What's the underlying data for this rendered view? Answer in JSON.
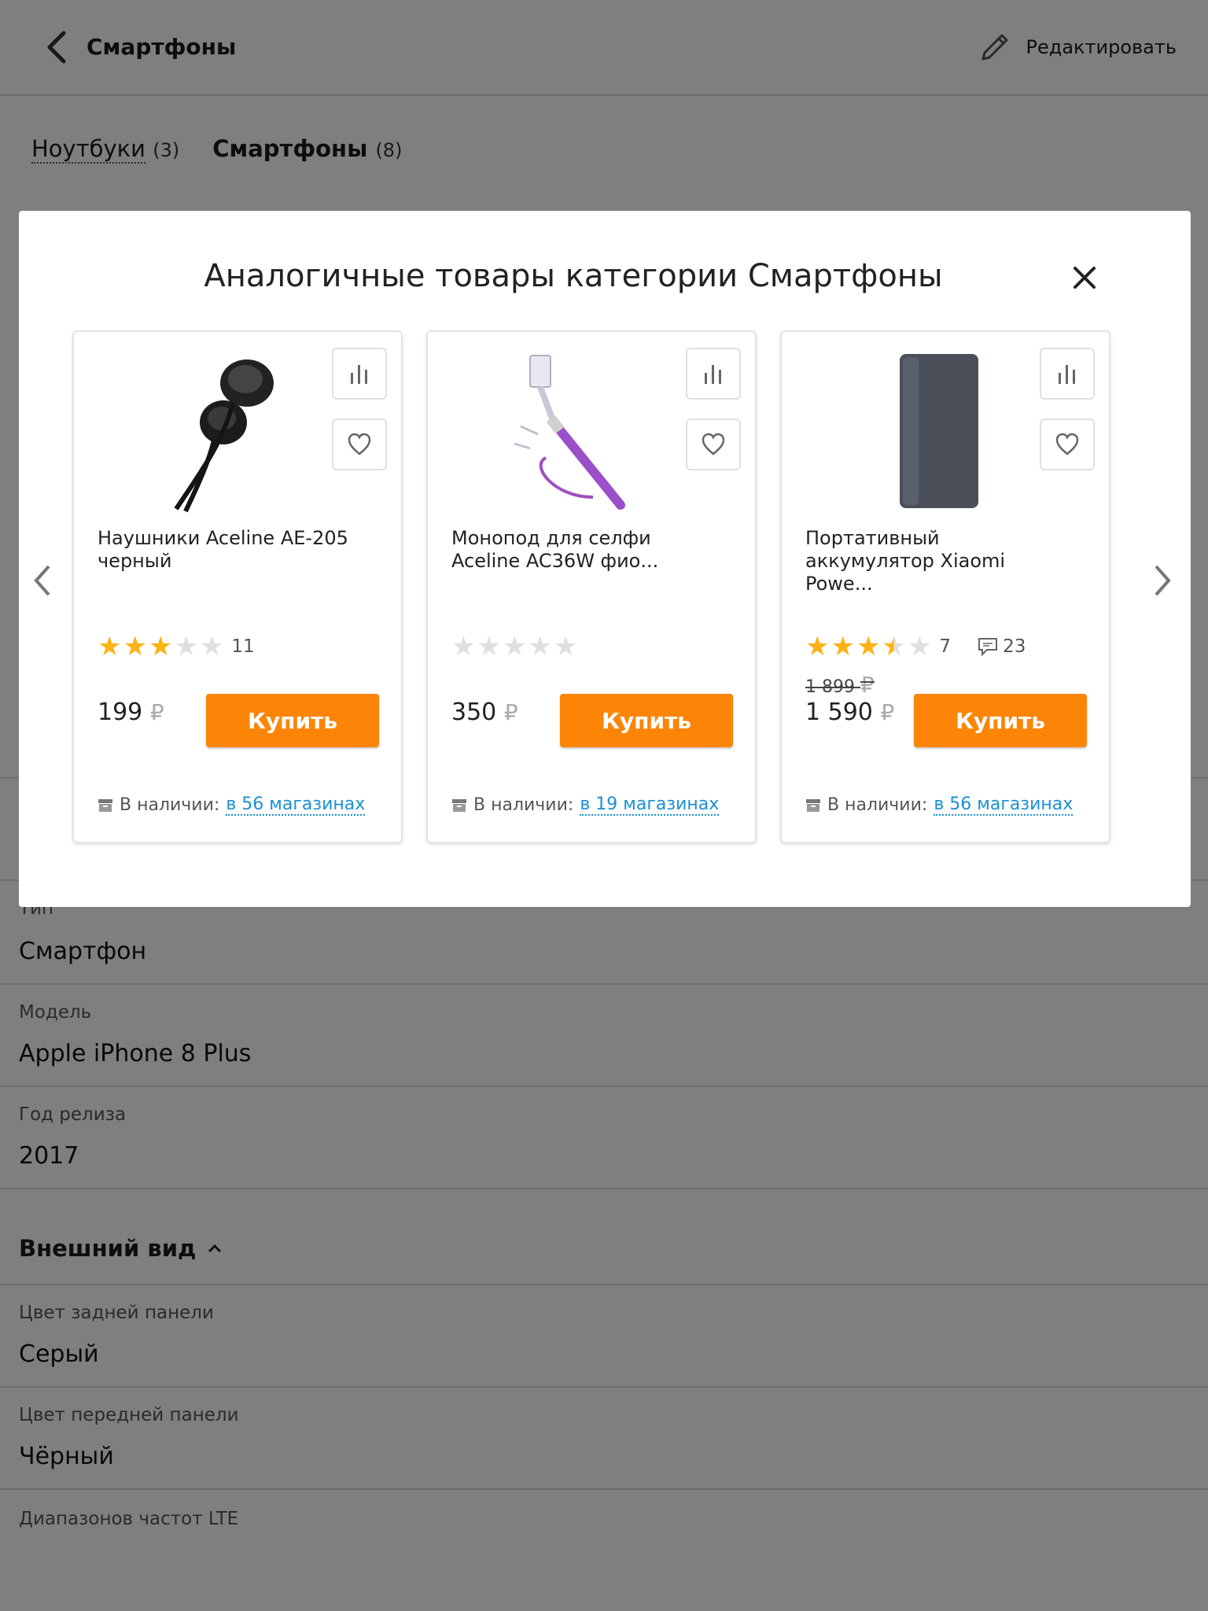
{
  "header": {
    "title": "Смартфоны",
    "edit_label": "Редактировать"
  },
  "tabs": [
    {
      "label": "Ноутбуки",
      "count": "(3)"
    },
    {
      "label": "Смартфоны",
      "count": "(8)"
    }
  ],
  "specs": {
    "type": {
      "label": "Тип",
      "value": "Смартфон"
    },
    "model": {
      "label": "Модель",
      "value": "Apple iPhone 8 Plus"
    },
    "year": {
      "label": "Год релиза",
      "value": "2017"
    },
    "section_title": "Внешний вид",
    "back_color": {
      "label": "Цвет задней панели",
      "value": "Серый"
    },
    "front_color": {
      "label": "Цвет передней панели",
      "value": "Чёрный"
    },
    "lte": {
      "label": "Диапазонов частот LTE"
    }
  },
  "modal": {
    "title": "Аналогичные товары категории Смартфоны",
    "currency": "₽",
    "buy_label": "Купить",
    "avail_prefix": "В наличии:",
    "cards": [
      {
        "name": "Наушники Aceline AE-205 черный",
        "rating": 3,
        "rating_count": "11",
        "price": "199",
        "stores": "в 56 магазинах"
      },
      {
        "name": "Монопод для селфи Aceline AC36W фио...",
        "rating": 0,
        "price": "350",
        "stores": "в 19 магазинах"
      },
      {
        "name": "Портативный аккумулятор Xiaomi Powe...",
        "rating": 3.5,
        "rating_count": "7",
        "reviews_count": "23",
        "old_price": "1 899",
        "price": "1 590",
        "stores": "в 56 магазинах"
      }
    ]
  },
  "colors": {
    "accent": "#fc8507",
    "star": "#fbb316",
    "link": "#1a8fd6"
  }
}
